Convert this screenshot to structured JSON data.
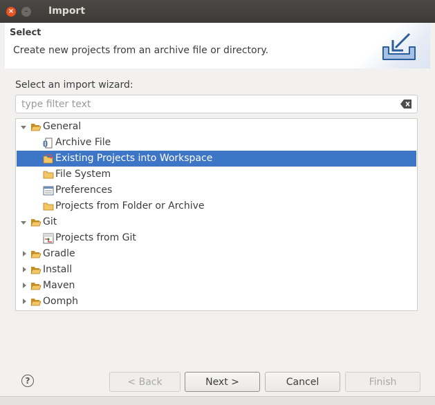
{
  "window": {
    "title": "Import",
    "close_glyph": "×",
    "minimize_glyph": "–"
  },
  "header": {
    "title": "Select",
    "description": "Create new projects from an archive file or directory."
  },
  "wizard": {
    "label": "Select an import wizard:",
    "filter_placeholder": "type filter text",
    "filter_value": ""
  },
  "tree": [
    {
      "label": "General",
      "expanded": true,
      "icon": "folder-open-icon"
    },
    {
      "label": "Archive File",
      "icon": "archive-file-icon"
    },
    {
      "label": "Existing Projects into Workspace",
      "icon": "existing-projects-icon",
      "selected": true
    },
    {
      "label": "File System",
      "icon": "folder-icon"
    },
    {
      "label": "Preferences",
      "icon": "preferences-icon"
    },
    {
      "label": "Projects from Folder or Archive",
      "icon": "folder-icon"
    },
    {
      "label": "Git",
      "expanded": true,
      "icon": "folder-open-icon"
    },
    {
      "label": "Projects from Git",
      "icon": "git-icon"
    },
    {
      "label": "Gradle",
      "expanded": false,
      "icon": "folder-open-icon"
    },
    {
      "label": "Install",
      "expanded": false,
      "icon": "folder-open-icon"
    },
    {
      "label": "Maven",
      "expanded": false,
      "icon": "folder-open-icon"
    },
    {
      "label": "Oomph",
      "expanded": false,
      "icon": "folder-open-icon"
    }
  ],
  "buttons": {
    "help": "?",
    "back": "< Back",
    "next": "Next >",
    "cancel": "Cancel",
    "finish": "Finish"
  },
  "colors": {
    "selection": "#3d75c7",
    "titlebar": "#3c3b37",
    "close": "#e95420",
    "folder": "#e9b44c"
  }
}
